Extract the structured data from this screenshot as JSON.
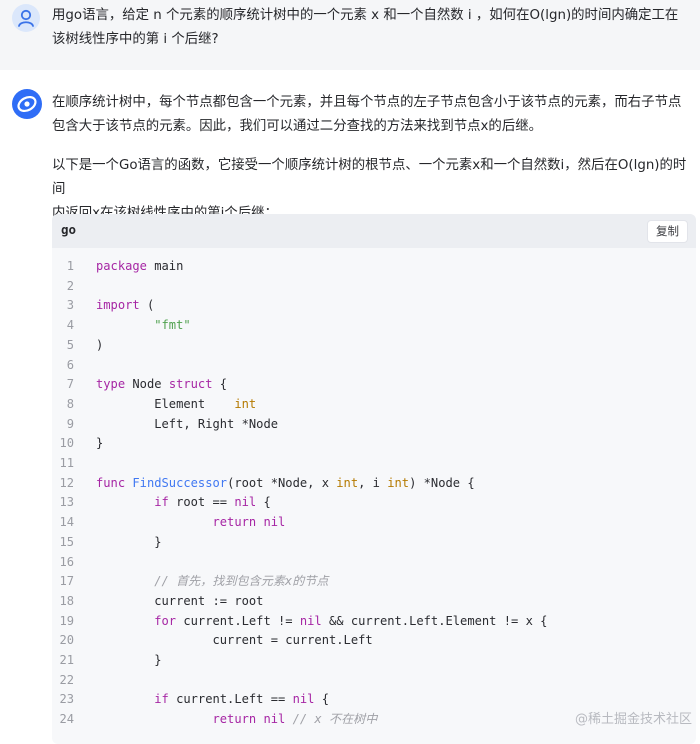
{
  "question": {
    "text": "用go语言，给定 n 个元素的顺序统计树中的一个元素 x 和一个自然数 i ，如何在O(lgn)的时间内确定工在\n该树线性序中的第 i 个后继?"
  },
  "answer": {
    "para1": "在顺序统计树中，每个节点都包含一个元素，并且每个节点的左子节点包含小于该节点的元素，而右子节点\n包含大于该节点的元素。因此，我们可以通过二分查找的方法来找到节点x的后继。",
    "para2": "以下是一个Go语言的函数，它接受一个顺序统计树的根节点、一个元素x和一个自然数i，然后在O(lgn)的时间\n内返回x在该树线性序中的第i个后继："
  },
  "code": {
    "language": "go",
    "copy_label": "复制",
    "lines": [
      [
        {
          "t": "k",
          "v": "package"
        },
        {
          "t": "p",
          "v": " main"
        }
      ],
      [],
      [
        {
          "t": "k",
          "v": "import"
        },
        {
          "t": "p",
          "v": " ("
        }
      ],
      [
        {
          "t": "p",
          "v": "        "
        },
        {
          "t": "s",
          "v": "\"fmt\""
        }
      ],
      [
        {
          "t": "p",
          "v": ")"
        }
      ],
      [],
      [
        {
          "t": "k",
          "v": "type"
        },
        {
          "t": "p",
          "v": " Node "
        },
        {
          "t": "k",
          "v": "struct"
        },
        {
          "t": "p",
          "v": " {"
        }
      ],
      [
        {
          "t": "p",
          "v": "        Element    "
        },
        {
          "t": "t",
          "v": "int"
        }
      ],
      [
        {
          "t": "p",
          "v": "        Left, Right *Node"
        }
      ],
      [
        {
          "t": "p",
          "v": "}"
        }
      ],
      [],
      [
        {
          "t": "k",
          "v": "func"
        },
        {
          "t": "p",
          "v": " "
        },
        {
          "t": "f",
          "v": "FindSuccessor"
        },
        {
          "t": "p",
          "v": "(root *Node, x "
        },
        {
          "t": "t",
          "v": "int"
        },
        {
          "t": "p",
          "v": ", i "
        },
        {
          "t": "t",
          "v": "int"
        },
        {
          "t": "p",
          "v": ") *Node {"
        }
      ],
      [
        {
          "t": "p",
          "v": "        "
        },
        {
          "t": "k",
          "v": "if"
        },
        {
          "t": "p",
          "v": " root == "
        },
        {
          "t": "k",
          "v": "nil"
        },
        {
          "t": "p",
          "v": " {"
        }
      ],
      [
        {
          "t": "p",
          "v": "                "
        },
        {
          "t": "k",
          "v": "return"
        },
        {
          "t": "p",
          "v": " "
        },
        {
          "t": "k",
          "v": "nil"
        }
      ],
      [
        {
          "t": "p",
          "v": "        }"
        }
      ],
      [],
      [
        {
          "t": "p",
          "v": "        "
        },
        {
          "t": "c",
          "v": "// 首先，找到包含元素x的节点"
        }
      ],
      [
        {
          "t": "p",
          "v": "        current := root"
        }
      ],
      [
        {
          "t": "p",
          "v": "        "
        },
        {
          "t": "k",
          "v": "for"
        },
        {
          "t": "p",
          "v": " current.Left != "
        },
        {
          "t": "k",
          "v": "nil"
        },
        {
          "t": "p",
          "v": " && current.Left.Element != x {"
        }
      ],
      [
        {
          "t": "p",
          "v": "                current = current.Left"
        }
      ],
      [
        {
          "t": "p",
          "v": "        }"
        }
      ],
      [],
      [
        {
          "t": "p",
          "v": "        "
        },
        {
          "t": "k",
          "v": "if"
        },
        {
          "t": "p",
          "v": " current.Left == "
        },
        {
          "t": "k",
          "v": "nil"
        },
        {
          "t": "p",
          "v": " {"
        }
      ],
      [
        {
          "t": "p",
          "v": "                "
        },
        {
          "t": "k",
          "v": "return"
        },
        {
          "t": "p",
          "v": " "
        },
        {
          "t": "k",
          "v": "nil"
        },
        {
          "t": "p",
          "v": " "
        },
        {
          "t": "c",
          "v": "// x 不在树中"
        }
      ]
    ]
  },
  "watermark": "@稀土掘金技术社区",
  "colors": {
    "accent": "#2f6df6",
    "user_band": "#f5f6f8",
    "code_bg": "#f7f8fa"
  }
}
